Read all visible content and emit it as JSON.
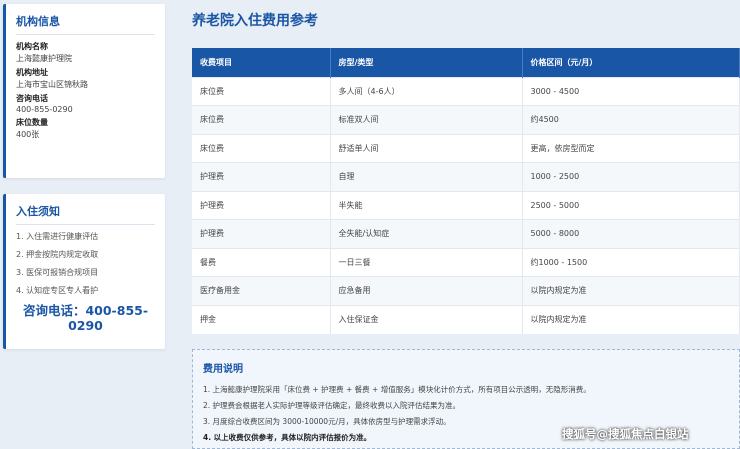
{
  "sidebar": {
    "info_card": {
      "title": "机构信息",
      "fields": [
        {
          "label": "机构名称",
          "value": "上海懿康护理院"
        },
        {
          "label": "机构地址",
          "value": "上海市宝山区锦秋路"
        },
        {
          "label": "咨询电话",
          "value": "400-855-0290"
        },
        {
          "label": "床位数量",
          "value": "400张"
        }
      ]
    },
    "notice_card": {
      "title": "入住须知",
      "items": [
        "1. 入住需进行健康评估",
        "2. 押金按院内规定收取",
        "3. 医保可报销合规项目",
        "4. 认知症专区专人看护"
      ],
      "hotline_line1": "咨询电话：400-855-",
      "hotline_line2": "0290"
    }
  },
  "main": {
    "title": "养老院入住费用参考",
    "table": {
      "headers": [
        "收费项目",
        "房型/类型",
        "价格区间（元/月）"
      ],
      "rows": [
        [
          "床位费",
          "多人间（4-6人）",
          "3000 - 4500"
        ],
        [
          "床位费",
          "标准双人间",
          "约4500"
        ],
        [
          "床位费",
          "舒适单人间",
          "更高，依房型而定"
        ],
        [
          "护理费",
          "自理",
          "1000 - 2500"
        ],
        [
          "护理费",
          "半失能",
          "2500 - 5000"
        ],
        [
          "护理费",
          "全失能/认知症",
          "5000 - 8000"
        ],
        [
          "餐费",
          "一日三餐",
          "约1000 - 1500"
        ],
        [
          "医疗备用金",
          "应急备用",
          "以院内规定为准"
        ],
        [
          "押金",
          "入住保证金",
          "以院内规定为准"
        ]
      ]
    },
    "notes": {
      "title": "费用说明",
      "lines": [
        "1. 上海懿康护理院采用「床位费 + 护理费 + 餐费 + 增值服务」模块化计价方式，所有项目公示透明，无隐形消费。",
        "2. 护理费会根据老人实际护理等级评估确定，最终收费以入院评估结果为准。",
        "3. 月度综合收费区间为 3000-10000元/月，具体依房型与护理需求浮动。",
        "4. 以上收费仅供参考，具体以院内评估报价为准。"
      ]
    }
  },
  "watermark": "搜狐号@搜狐焦点白银站",
  "colors": {
    "accent": "#1a56a6",
    "background": "#e8eef5"
  }
}
